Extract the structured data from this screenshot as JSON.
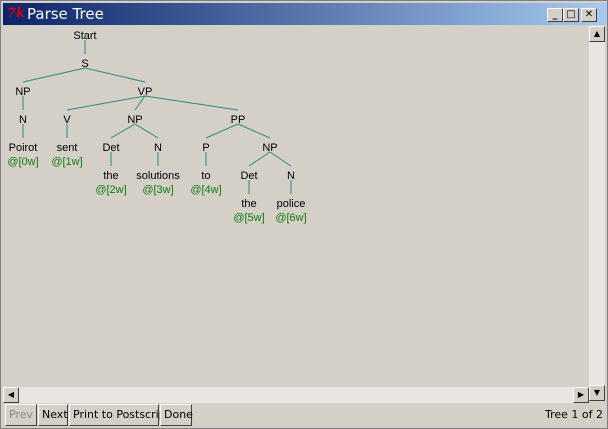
{
  "window": {
    "title": "Parse Tree",
    "icon_text": "7k"
  },
  "tree": {
    "nodes": [
      {
        "id": "start",
        "label": "Start"
      },
      {
        "id": "s",
        "label": "S"
      },
      {
        "id": "np1",
        "label": "NP"
      },
      {
        "id": "vp",
        "label": "VP"
      },
      {
        "id": "n1",
        "label": "N"
      },
      {
        "id": "poirot",
        "label": "Poirot"
      },
      {
        "id": "w0",
        "label": "@[0w]",
        "kind": "index"
      },
      {
        "id": "v",
        "label": "V"
      },
      {
        "id": "sent",
        "label": "sent"
      },
      {
        "id": "w1",
        "label": "@[1w]",
        "kind": "index"
      },
      {
        "id": "np2",
        "label": "NP"
      },
      {
        "id": "det1",
        "label": "Det"
      },
      {
        "id": "the1",
        "label": "the"
      },
      {
        "id": "w2",
        "label": "@[2w]",
        "kind": "index"
      },
      {
        "id": "n2",
        "label": "N"
      },
      {
        "id": "solutions",
        "label": "solutions"
      },
      {
        "id": "w3",
        "label": "@[3w]",
        "kind": "index"
      },
      {
        "id": "pp",
        "label": "PP"
      },
      {
        "id": "p",
        "label": "P"
      },
      {
        "id": "to",
        "label": "to"
      },
      {
        "id": "w4",
        "label": "@[4w]",
        "kind": "index"
      },
      {
        "id": "np3",
        "label": "NP"
      },
      {
        "id": "det2",
        "label": "Det"
      },
      {
        "id": "the2",
        "label": "the"
      },
      {
        "id": "w5",
        "label": "@[5w]",
        "kind": "index"
      },
      {
        "id": "n3",
        "label": "N"
      },
      {
        "id": "police",
        "label": "police"
      },
      {
        "id": "w6",
        "label": "@[6w]",
        "kind": "index"
      }
    ],
    "edges": [
      [
        "start",
        "s"
      ],
      [
        "s",
        "np1"
      ],
      [
        "s",
        "vp"
      ],
      [
        "np1",
        "n1"
      ],
      [
        "n1",
        "poirot"
      ],
      [
        "vp",
        "v"
      ],
      [
        "vp",
        "np2"
      ],
      [
        "vp",
        "pp"
      ],
      [
        "v",
        "sent"
      ],
      [
        "np2",
        "det1"
      ],
      [
        "np2",
        "n2"
      ],
      [
        "det1",
        "the1"
      ],
      [
        "n2",
        "solutions"
      ],
      [
        "pp",
        "p"
      ],
      [
        "pp",
        "np3"
      ],
      [
        "p",
        "to"
      ],
      [
        "np3",
        "det2"
      ],
      [
        "np3",
        "n3"
      ],
      [
        "det2",
        "the2"
      ],
      [
        "n3",
        "police"
      ]
    ],
    "line_color": "#2a8c7a",
    "index_color": "#107c10"
  },
  "buttons": {
    "prev": "Prev",
    "next": "Next",
    "print": "Print to Postscript",
    "done": "Done"
  },
  "status": "Tree 1 of 2"
}
